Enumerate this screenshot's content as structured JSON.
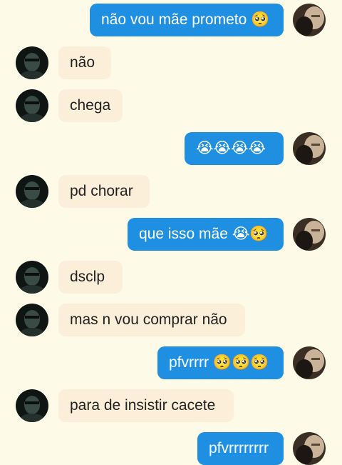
{
  "colors": {
    "background": "#fdfae7",
    "incoming_bubble": "#fbefd9",
    "outgoing_bubble": "#1e8fe1"
  },
  "messages": [
    {
      "side": "out",
      "text": "não vou mãe prometo 🥺"
    },
    {
      "side": "in",
      "text": "não"
    },
    {
      "side": "in",
      "text": "chega"
    },
    {
      "side": "out",
      "text": "😭😭😭😭"
    },
    {
      "side": "in",
      "text": "pd chorar"
    },
    {
      "side": "out",
      "text": "que isso mãe 😭🥺"
    },
    {
      "side": "in",
      "text": "dsclp"
    },
    {
      "side": "in",
      "text": "mas n vou comprar não"
    },
    {
      "side": "out",
      "text": "pfvrrrr 🥺🥺🥺"
    },
    {
      "side": "in",
      "text": "para de insistir cacete"
    },
    {
      "side": "out",
      "text": "pfvrrrrrrrr"
    }
  ]
}
